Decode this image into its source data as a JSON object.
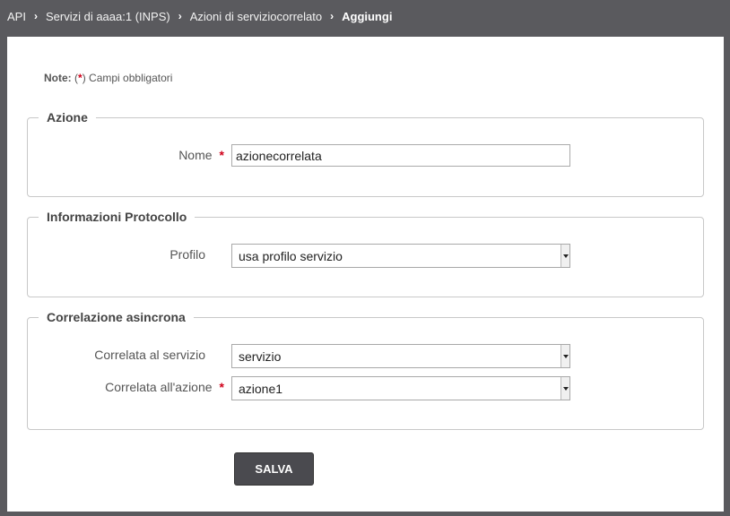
{
  "breadcrumb": {
    "items": [
      "API",
      "Servizi di aaaa:1 (INPS)",
      "Azioni di serviziocorrelato",
      "Aggiungi"
    ],
    "separator": "›"
  },
  "note": {
    "label": "Note:",
    "open": "(",
    "star": "*",
    "close": ")",
    "text": "Campi obbligatori"
  },
  "sections": {
    "azione": {
      "legend": "Azione",
      "nome_label": "Nome",
      "nome_value": "azionecorrelata",
      "required_mark": "*"
    },
    "protocollo": {
      "legend": "Informazioni Protocollo",
      "profilo_label": "Profilo",
      "profilo_value": "usa profilo servizio"
    },
    "correlazione": {
      "legend": "Correlazione asincrona",
      "servizio_label": "Correlata al servizio",
      "servizio_value": "servizio",
      "azione_label": "Correlata all'azione",
      "azione_value": "azione1",
      "required_mark": "*"
    }
  },
  "actions": {
    "save_label": "SALVA"
  },
  "colors": {
    "background": "#5a5a5e",
    "panel": "#ffffff",
    "required": "#d0021b",
    "button": "#4a4a4f"
  }
}
